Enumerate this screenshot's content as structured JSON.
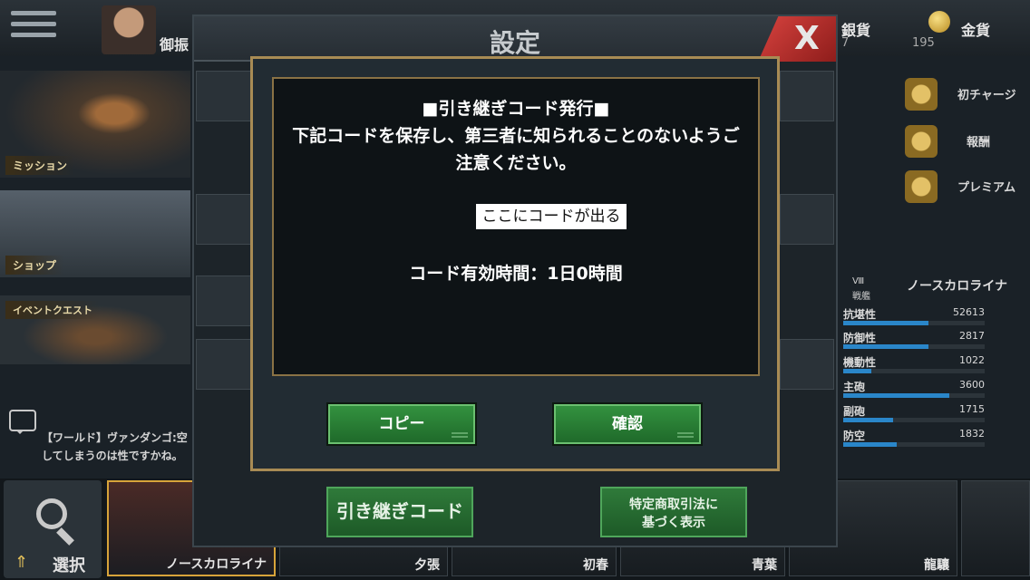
{
  "hud": {
    "top_left_label": "御振",
    "silver_label": "銀貨",
    "silver_value": "7",
    "gold_label": "金貨",
    "gold_value": "195"
  },
  "left_menu": {
    "mission": "ミッション",
    "shop": "ショップ",
    "event": "イベントクエスト"
  },
  "right_menu": [
    "初チャージ",
    "報酬",
    "プレミアム"
  ],
  "ship": {
    "tier": "Ⅷ",
    "name": "ノースカロライナ",
    "class": "戦艦",
    "stats": [
      {
        "name": "抗堪性",
        "value": "52613",
        "fill": 0.6
      },
      {
        "name": "防御性",
        "value": "2817",
        "fill": 0.6
      },
      {
        "name": "機動性",
        "value": "1022",
        "fill": 0.2
      },
      {
        "name": "主砲",
        "value": "3600",
        "fill": 0.75
      },
      {
        "name": "副砲",
        "value": "1715",
        "fill": 0.35
      },
      {
        "name": "防空",
        "value": "1832",
        "fill": 0.38
      }
    ]
  },
  "chat": {
    "line1": "【ワールド】ヴァンダンゴ:空",
    "line2": "してしまうのは性ですかね。"
  },
  "bottom_bar": {
    "select_label": "選択",
    "ships": [
      "ノースカロライナ",
      "夕張",
      "初春",
      "青葉",
      "龍驤"
    ]
  },
  "settings": {
    "title": "設定",
    "close": "X",
    "takeover_button": "引き継ぎコード",
    "legal_button_line1": "特定商取引法に",
    "legal_button_line2": "基づく表示"
  },
  "dialog": {
    "heading": "■引き継ぎコード発行■",
    "message_line1": "下記コードを保存し、第三者に知られることのないようご",
    "message_line2": "注意ください。",
    "code": "ここにコードが出る",
    "validity": "コード有効時間：1日0時間",
    "copy_button": "コピー",
    "confirm_button": "確認"
  }
}
